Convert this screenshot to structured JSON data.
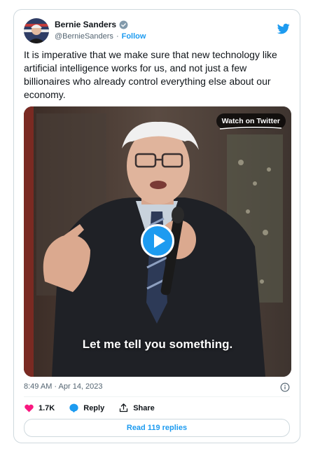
{
  "author": {
    "name": "Bernie Sanders",
    "handle": "@BernieSanders",
    "separator": "·",
    "follow_label": "Follow"
  },
  "tweet": {
    "text": "It is imperative that we make sure that new technology like artificial intelligence works for us, and not just a few billionaires who already control everything else about our economy."
  },
  "video": {
    "watch_label": "Watch on Twitter",
    "caption": "Let me tell you something."
  },
  "meta": {
    "timestamp": "8:49 AM · Apr 14, 2023"
  },
  "actions": {
    "likes": "1.7K",
    "reply_label": "Reply",
    "share_label": "Share"
  },
  "replies_label": "Read 119 replies",
  "colors": {
    "accent": "#1d9bf0",
    "like": "#f91880",
    "text": "#0f1419",
    "muted": "#536471"
  }
}
